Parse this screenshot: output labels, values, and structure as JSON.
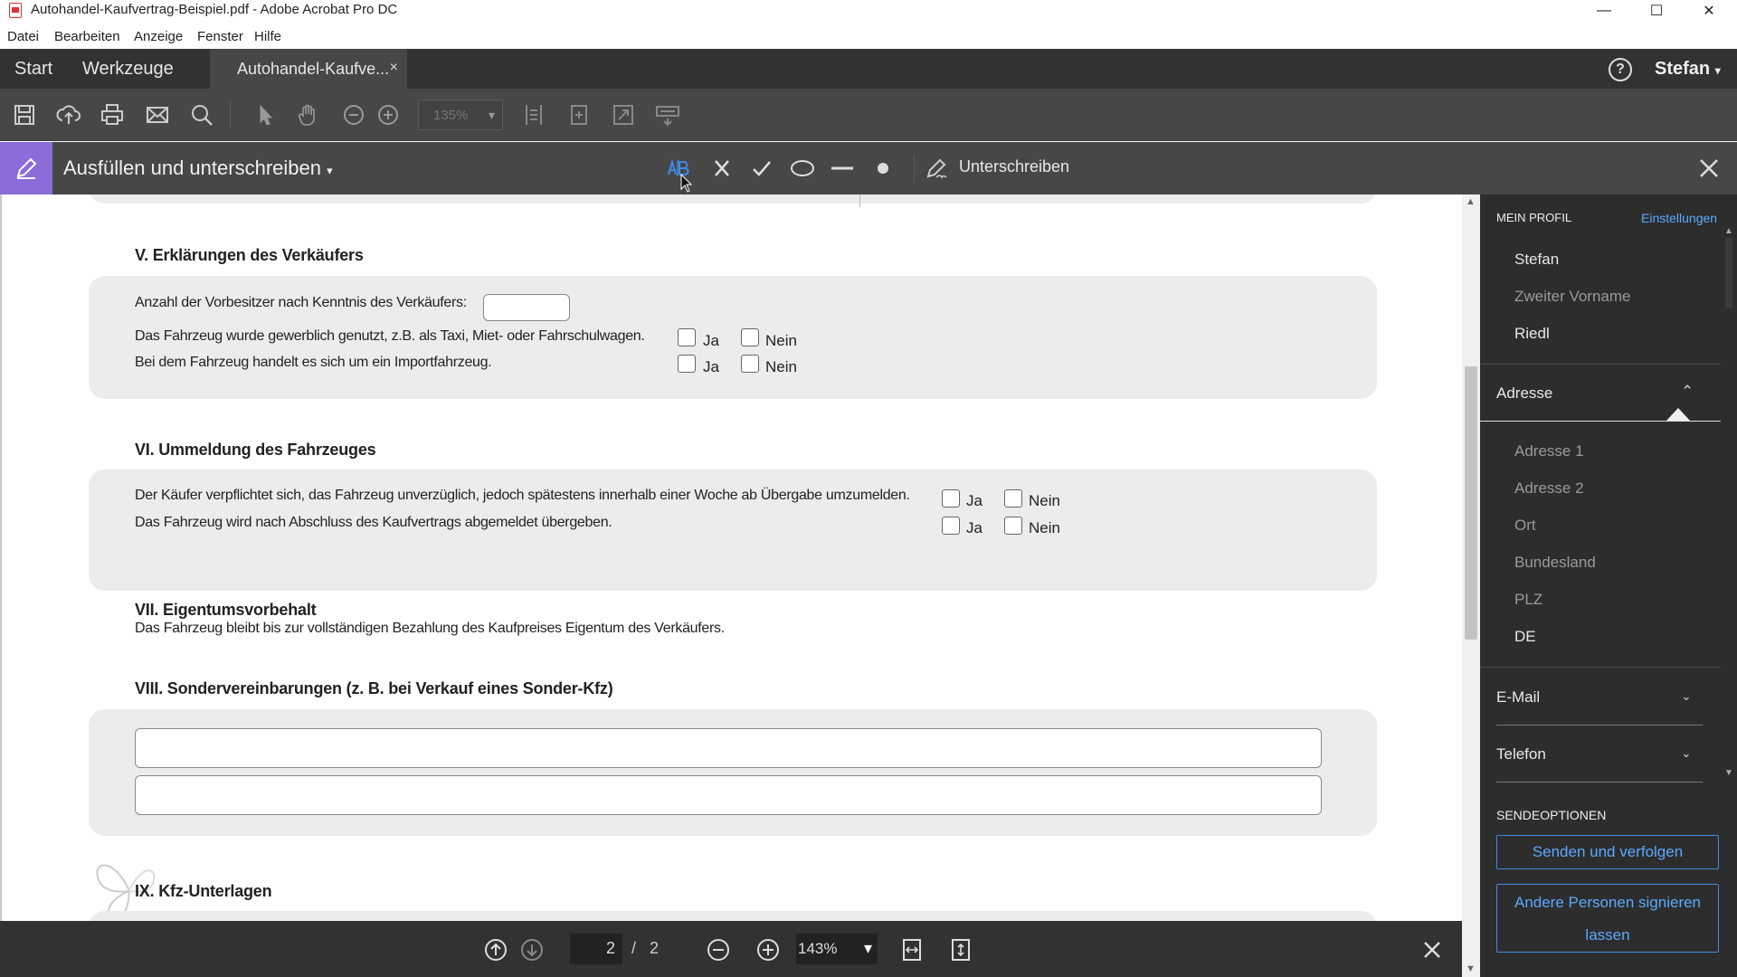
{
  "window": {
    "title": "Autohandel-Kaufvertrag-Beispiel.pdf - Adobe Acrobat Pro DC",
    "minimize": "—",
    "maximize": "☐",
    "close": "✕"
  },
  "menu": [
    "Datei",
    "Bearbeiten",
    "Anzeige",
    "Fenster",
    "Hilfe"
  ],
  "tabs": {
    "start": "Start",
    "tools": "Werkzeuge",
    "document": "Autohandel-Kaufve...",
    "document_close": "×",
    "user": "Stefan"
  },
  "toolbar": {
    "zoom": "135%"
  },
  "fill_sign": {
    "title": "Ausfüllen und unterschreiben",
    "sign_label": "Unterschreiben"
  },
  "document": {
    "section5": {
      "title": "V. Erklärungen des Verkäufers",
      "row1": "Anzahl der Vorbesitzer nach Kenntnis des Verkäufers:",
      "row2": "Das Fahrzeug wurde gewerblich genutzt, z.B. als Taxi, Miet- oder Fahrschulwagen.",
      "row3": "Bei dem Fahrzeug handelt es sich um ein Importfahrzeug."
    },
    "section6": {
      "title": "VI. Ummeldung des Fahrzeuges",
      "row1": "Der Käufer verpflichtet sich, das Fahrzeug unverzüglich, jedoch spätestens innerhalb einer Woche ab Übergabe umzumelden.",
      "row2": "Das Fahrzeug wird nach Abschluss des Kaufvertrags abgemeldet übergeben."
    },
    "section7": {
      "title": "VII. Eigentumsvorbehalt",
      "text": "Das Fahrzeug bleibt bis zur vollständigen Bezahlung des Kaufpreises Eigentum des Verkäufers."
    },
    "section8": {
      "title": "VIII. Sondervereinbarungen (z. B. bei Verkauf eines Sonder-Kfz)"
    },
    "section9": {
      "title": "IX. Kfz-Unterlagen"
    },
    "yes": "Ja",
    "no": "Nein"
  },
  "pager": {
    "current": "2",
    "separator": "/",
    "total": "2",
    "zoom": "143%"
  },
  "right_panel": {
    "profile_header": "MEIN PROFIL",
    "settings_link": "Einstellungen",
    "first_name": "Stefan",
    "middle_name": "Zweiter Vorname",
    "last_name": "Riedl",
    "address_header": "Adresse",
    "address1": "Adresse 1",
    "address2": "Adresse 2",
    "city": "Ort",
    "state": "Bundesland",
    "zip": "PLZ",
    "country": "DE",
    "email": "E-Mail",
    "phone": "Telefon",
    "send_header": "SENDEOPTIONEN",
    "send_track": "Senden und verfolgen",
    "others_sign_line1": "Andere Personen signieren",
    "others_sign_line2": "lassen"
  },
  "colors": {
    "accent": "#8b6cd9",
    "link": "#5aa9ff",
    "panel_bg": "#2d2d2d"
  }
}
